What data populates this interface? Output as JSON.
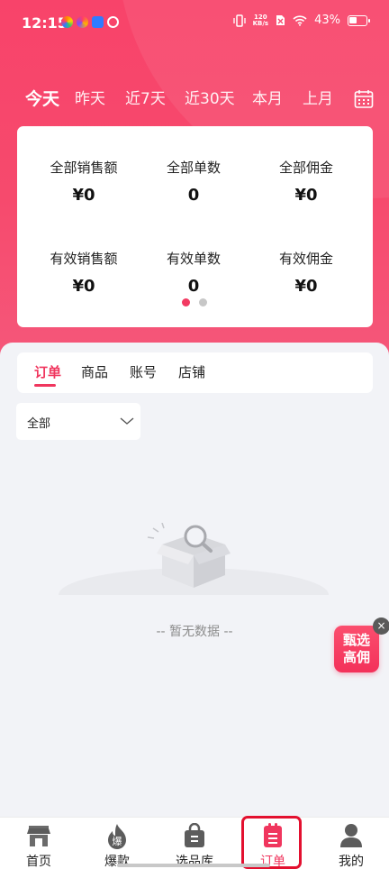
{
  "status_bar": {
    "time": "12:15",
    "net_speed_value": "120",
    "net_speed_unit": "KB/s",
    "battery": "43%"
  },
  "date_tabs": [
    {
      "label": "今天",
      "active": true
    },
    {
      "label": "昨天"
    },
    {
      "label": "近7天"
    },
    {
      "label": "近30天"
    },
    {
      "label": "本月"
    },
    {
      "label": "上月"
    }
  ],
  "stats": [
    {
      "label": "全部销售额",
      "value": "¥0"
    },
    {
      "label": "全部单数",
      "value": "0"
    },
    {
      "label": "全部佣金",
      "value": "¥0"
    },
    {
      "label": "有效销售额",
      "value": "¥0"
    },
    {
      "label": "有效单数",
      "value": "0"
    },
    {
      "label": "有效佣金",
      "value": "¥0"
    }
  ],
  "pager": {
    "count": 2,
    "active_index": 0
  },
  "content_tabs": [
    {
      "label": "订单",
      "active": true
    },
    {
      "label": "商品"
    },
    {
      "label": "账号"
    },
    {
      "label": "店铺"
    }
  ],
  "filter": {
    "selected": "全部"
  },
  "empty_state": {
    "text": "-- 暂无数据 --"
  },
  "float_badge": {
    "line1": "甄选",
    "line2": "高佣",
    "close": "×"
  },
  "bottom_nav": [
    {
      "label": "首页",
      "icon": "store-icon"
    },
    {
      "label": "爆款",
      "icon": "flame-icon",
      "icon_text": "爆"
    },
    {
      "label": "选品库",
      "icon": "bag-icon"
    },
    {
      "label": "订单",
      "icon": "order-clipboard-icon",
      "active": true
    },
    {
      "label": "我的",
      "icon": "person-icon"
    }
  ],
  "colors": {
    "brand": "#f0365e",
    "hero": "#f8436a",
    "highlight_box": "#e3102f"
  }
}
